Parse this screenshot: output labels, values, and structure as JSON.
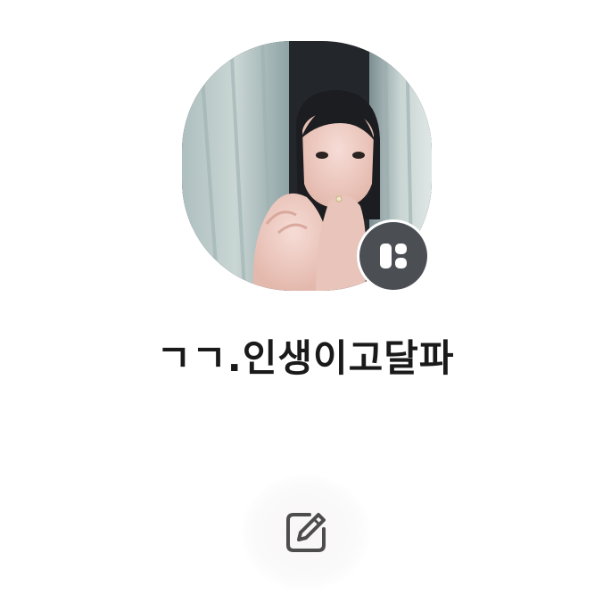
{
  "profile": {
    "name": "ㄱㄱ.인생이고달파",
    "avatar_icon": "profile-photo",
    "badge_icon": "kakao-story-icon"
  },
  "actions": {
    "edit_icon": "edit-icon"
  },
  "colors": {
    "badge_bg": "#4b4f54",
    "name_text": "#1a1a1a",
    "edit_icon_stroke": "#4d4d4d"
  }
}
